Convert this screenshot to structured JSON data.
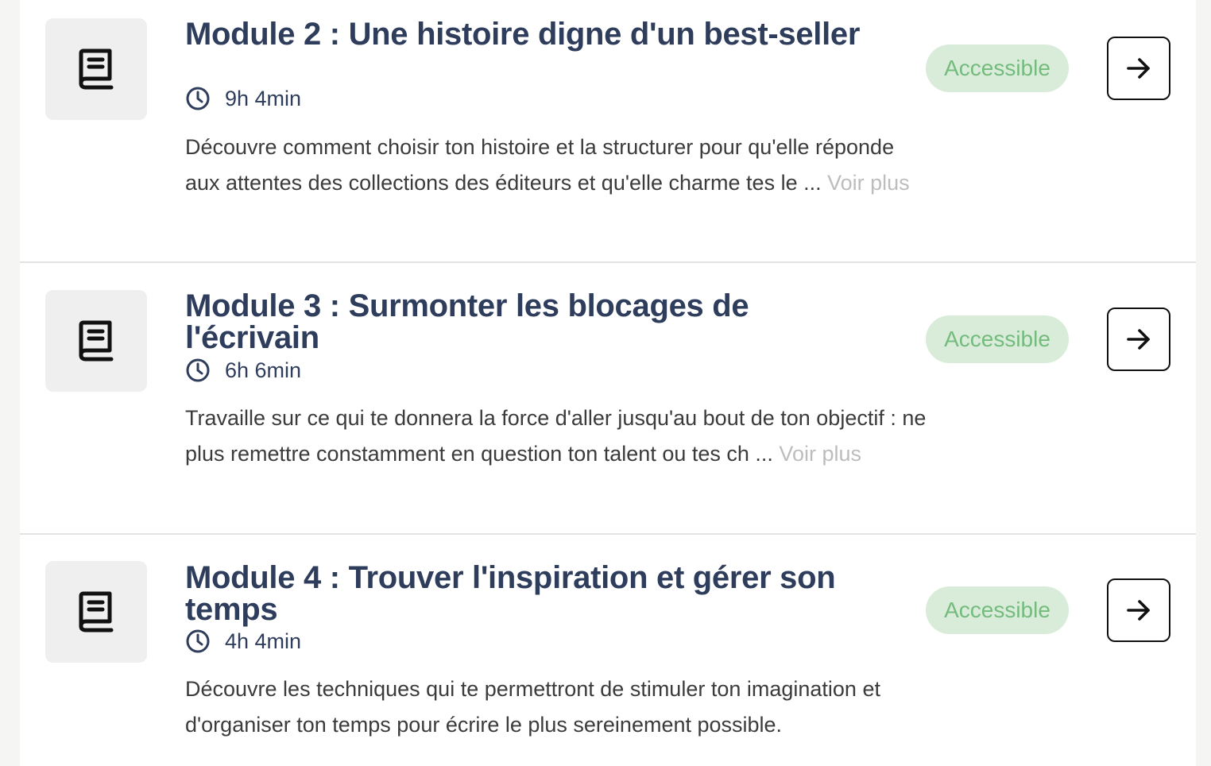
{
  "modules": [
    {
      "title": "Module 2 : Une histoire digne d'un best-seller",
      "duration": "9h 4min",
      "description": "Découvre comment choisir ton histoire et la structurer pour qu'elle réponde aux attentes des collections des éditeurs et qu'elle charme tes le ...",
      "more_label": "Voir plus",
      "status": "Accessible"
    },
    {
      "title": "Module 3 : Surmonter les blocages de l'écrivain",
      "duration": "6h 6min",
      "description": "Travaille sur ce qui te donnera la force d'aller jusqu'au bout de ton objectif : ne plus remettre constamment en question ton talent ou tes ch ...",
      "more_label": "Voir plus",
      "status": "Accessible"
    },
    {
      "title": "Module 4 : Trouver l'inspiration et gérer son temps",
      "duration": "4h 4min",
      "description": "Découvre les techniques qui te permettront de stimuler ton imagination et d'organiser ton temps pour écrire le plus sereinement possible.",
      "status": "Accessible"
    }
  ],
  "icons": {
    "thumbnail": "book-icon",
    "duration": "clock-icon",
    "open": "arrow-right-icon"
  },
  "colors": {
    "title": "#2f3d5c",
    "badge_bg": "#d9ecda",
    "badge_text": "#74bb7d",
    "more_link": "#bdbdbd"
  }
}
